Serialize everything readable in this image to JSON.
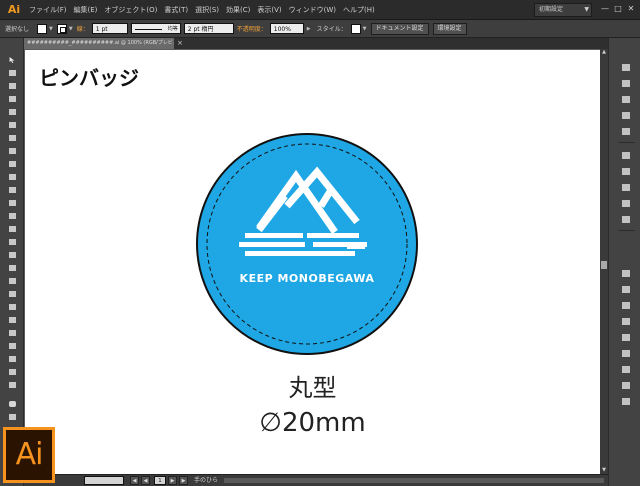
{
  "app": {
    "logo_small": "Ai",
    "logo_large": "Ai"
  },
  "menu": [
    "ファイル(F)",
    "編集(E)",
    "オブジェクト(O)",
    "書式(T)",
    "選択(S)",
    "効果(C)",
    "表示(V)",
    "ウィンドウ(W)",
    "ヘルプ(H)"
  ],
  "workspace": {
    "label": "初期設定"
  },
  "window_controls": [
    "—",
    "□",
    "✕"
  ],
  "control_bar": {
    "selection_label": "選択なし",
    "stroke_label": "線：",
    "stroke_weight": "1 pt",
    "stroke_style": "均等",
    "brush": "2 pt 楕円",
    "opacity_label": "不透明度：",
    "opacity_value": "100%",
    "style_label": "スタイル：",
    "doc_settings_button": "ドキュメント設定",
    "prefs_button": "環境設定"
  },
  "document_tab": {
    "title": "##########_##########.ai @ 100% (RGB/プレビュー)",
    "close": "×"
  },
  "artboard": {
    "title": "ピンバッジ",
    "badge_text": "KEEP MONOBEGAWA",
    "shape_label": "丸型",
    "size_label": "∅20mm"
  },
  "badge_colors": {
    "fill": "#1ea7e4",
    "outline": "#111111",
    "mark": "#ffffff"
  },
  "status_bar": {
    "page": "1",
    "tool_status": "手のひら"
  },
  "tool_icons": [
    "selection-tool-icon",
    "direct-selection-tool-icon",
    "magic-wand-icon",
    "lasso-icon",
    "pen-tool-icon",
    "type-tool-icon",
    "line-tool-icon",
    "rectangle-tool-icon",
    "paintbrush-icon",
    "pencil-icon",
    "blob-brush-icon",
    "eraser-icon",
    "rotate-icon",
    "scale-icon",
    "width-tool-icon",
    "free-transform-icon",
    "shape-builder-icon",
    "perspective-grid-icon",
    "mesh-icon",
    "gradient-icon",
    "eyedropper-icon",
    "blend-icon",
    "symbol-sprayer-icon",
    "column-graph-icon",
    "artboard-tool-icon",
    "slice-tool-icon",
    "hand-tool-icon",
    "zoom-tool-icon"
  ],
  "dock_icons": [
    "color-icon",
    "color-guide-icon",
    "swatches-icon",
    "brushes-icon",
    "symbols-icon",
    "graphic-styles-icon",
    "stroke-icon",
    "gradient-panel-icon",
    "transparency-icon",
    "appearance-icon",
    "layers-icon",
    "artboards-icon",
    "character-icon",
    "paragraph-icon",
    "opentype-icon",
    "align-icon",
    "pathfinder-icon",
    "transform-icon",
    "links-icon"
  ]
}
